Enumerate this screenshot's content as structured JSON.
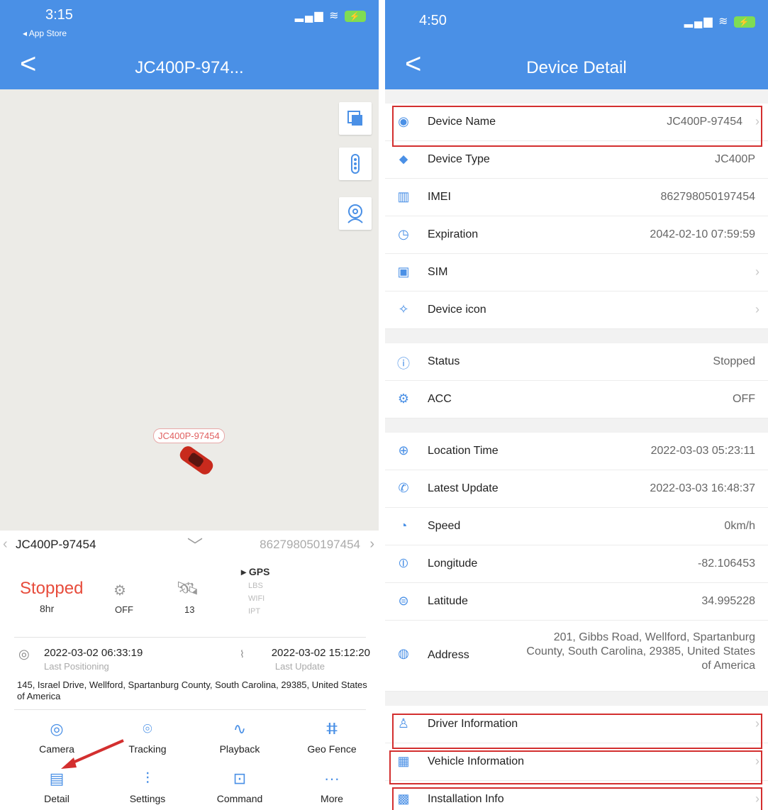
{
  "left": {
    "status": {
      "time": "3:15",
      "back_app": "◂ App Store",
      "signal": "▂▄▆",
      "wifi": "≋"
    },
    "nav": {
      "back": "<",
      "title": "JC400P-974..."
    },
    "map": {
      "car_label": "JC400P-97454"
    },
    "device_bar": {
      "name": "JC400P-97454",
      "imei": "862798050197454"
    },
    "stats": {
      "state": "Stopped",
      "duration": "8hr",
      "acc": "OFF",
      "satellites": "13",
      "modes": [
        "GPS",
        "LBS",
        "WIFI",
        "IPT"
      ],
      "active_mode": "GPS"
    },
    "positioning": {
      "last_positioning_time": "2022-03-02 06:33:19",
      "last_positioning_label": "Last Positioning",
      "last_update_time": "2022-03-02 15:12:20",
      "last_update_label": "Last Update",
      "address": "145, Israel Drive, Wellford, Spartanburg County, South Carolina, 29385, United States of America"
    },
    "functions": [
      {
        "label": "Camera",
        "icon": "camera-icon"
      },
      {
        "label": "Tracking",
        "icon": "location-pin-icon"
      },
      {
        "label": "Playback",
        "icon": "route-icon"
      },
      {
        "label": "Geo Fence",
        "icon": "fence-icon"
      },
      {
        "label": "Detail",
        "icon": "document-icon"
      },
      {
        "label": "Settings",
        "icon": "sliders-icon"
      },
      {
        "label": "Command",
        "icon": "terminal-icon"
      },
      {
        "label": "More",
        "icon": "more-dots-icon"
      }
    ]
  },
  "right": {
    "status": {
      "time": "4:50"
    },
    "nav": {
      "back": "<",
      "title": "Device Detail"
    },
    "groups": [
      [
        {
          "label": "Device Name",
          "value": "JC400P-97454",
          "chevron": true,
          "icon": "antenna-icon"
        },
        {
          "label": "Device Type",
          "value": "JC400P",
          "chevron": false,
          "icon": "tag-icon"
        },
        {
          "label": "IMEI",
          "value": "862798050197454",
          "chevron": false,
          "icon": "barcode-icon"
        },
        {
          "label": "Expiration",
          "value": "2042-02-10 07:59:59",
          "chevron": false,
          "icon": "clock-icon"
        },
        {
          "label": "SIM",
          "value": "",
          "chevron": true,
          "icon": "sim-icon"
        },
        {
          "label": "Device icon",
          "value": "",
          "chevron": true,
          "icon": "device-icon-icon"
        }
      ],
      [
        {
          "label": "Status",
          "value": "Stopped",
          "chevron": false,
          "icon": "info-circle-icon"
        },
        {
          "label": "ACC",
          "value": "OFF",
          "chevron": false,
          "icon": "engine-icon"
        }
      ],
      [
        {
          "label": "Location Time",
          "value": "2022-03-03 05:23:11",
          "chevron": false,
          "icon": "crosshair-icon"
        },
        {
          "label": "Latest Update",
          "value": "2022-03-03 16:48:37",
          "chevron": false,
          "icon": "satellite-icon"
        },
        {
          "label": "Speed",
          "value": "0km/h",
          "chevron": false,
          "icon": "speedometer-icon"
        },
        {
          "label": "Longitude",
          "value": "-82.106453",
          "chevron": false,
          "icon": "longitude-icon"
        },
        {
          "label": "Latitude",
          "value": "34.995228",
          "chevron": false,
          "icon": "latitude-icon"
        },
        {
          "label": "Address",
          "value": "201, Gibbs Road, Wellford, Spartanburg County, South Carolina, 29385, United States of America",
          "chevron": false,
          "icon": "map-pin-icon",
          "tall": true
        }
      ],
      [
        {
          "label": "Driver Information",
          "value": "",
          "chevron": true,
          "icon": "person-icon"
        },
        {
          "label": "Vehicle Information",
          "value": "",
          "chevron": true,
          "icon": "vehicle-icon"
        },
        {
          "label": "Installation Info",
          "value": "",
          "chevron": true,
          "icon": "install-icon"
        }
      ]
    ]
  },
  "colors": {
    "accent": "#4a90e6",
    "stopped": "#e74c3c",
    "highlight": "#d32f2f"
  }
}
